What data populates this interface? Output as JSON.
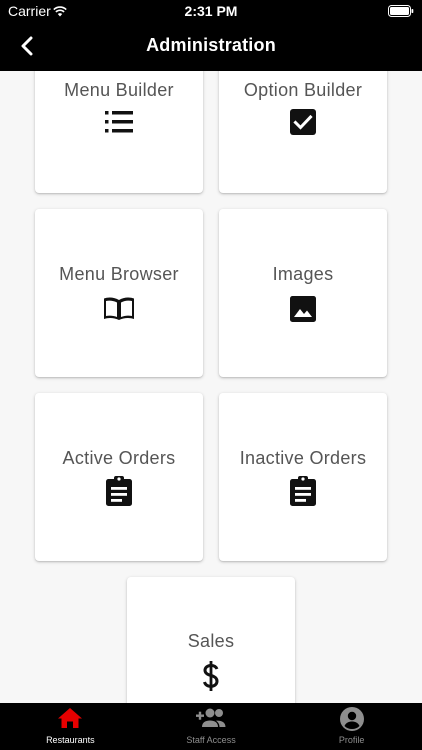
{
  "status_bar": {
    "carrier": "Carrier",
    "time": "2:31 PM"
  },
  "header": {
    "title": "Administration"
  },
  "cards": [
    {
      "label": "Menu Builder",
      "icon": "list-icon"
    },
    {
      "label": "Option Builder",
      "icon": "checkbox-icon"
    },
    {
      "label": "Menu Browser",
      "icon": "book-icon"
    },
    {
      "label": "Images",
      "icon": "image-icon"
    },
    {
      "label": "Active Orders",
      "icon": "clipboard-icon"
    },
    {
      "label": "Inactive Orders",
      "icon": "clipboard-icon"
    },
    {
      "label": "Sales",
      "icon": "dollar-icon"
    }
  ],
  "tabs": [
    {
      "label": "Restaurants",
      "icon": "home-icon",
      "active": true
    },
    {
      "label": "Staff Access",
      "icon": "people-add-icon",
      "active": false
    },
    {
      "label": "Profile",
      "icon": "account-icon",
      "active": false
    }
  ],
  "colors": {
    "accent": "#e60000",
    "header_bg": "#000000",
    "background": "#f7f7f7"
  }
}
